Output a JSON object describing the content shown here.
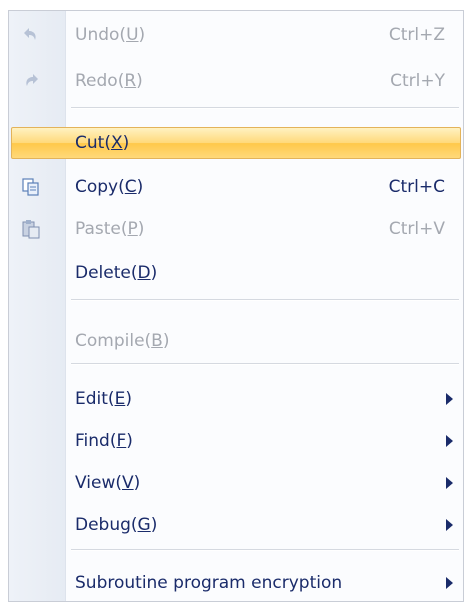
{
  "menu": {
    "undo": {
      "label": "Undo",
      "key": "U",
      "shortcut": "Ctrl+Z",
      "icon": "undo-icon"
    },
    "redo": {
      "label": "Redo",
      "key": "R",
      "shortcut": "Ctrl+Y",
      "icon": "redo-icon"
    },
    "cut": {
      "label": "Cut",
      "key": "X"
    },
    "copy": {
      "label": "Copy",
      "key": "C",
      "shortcut": "Ctrl+C",
      "icon": "copy-icon"
    },
    "paste": {
      "label": "Paste",
      "key": "P",
      "shortcut": "Ctrl+V",
      "icon": "paste-icon"
    },
    "delete": {
      "label": "Delete",
      "key": "D"
    },
    "compile": {
      "label": "Compile",
      "key": "B"
    },
    "edit": {
      "label": "Edit",
      "key": "E"
    },
    "find": {
      "label": "Find",
      "key": "F"
    },
    "view": {
      "label": "View",
      "key": "V"
    },
    "debug": {
      "label": "Debug",
      "key": "G"
    },
    "encryption": {
      "label": "Subroutine program encryption"
    }
  },
  "colors": {
    "text": "#1a2b6a",
    "disabled": "#a4a8b0",
    "highlight": "#ffd97a"
  }
}
